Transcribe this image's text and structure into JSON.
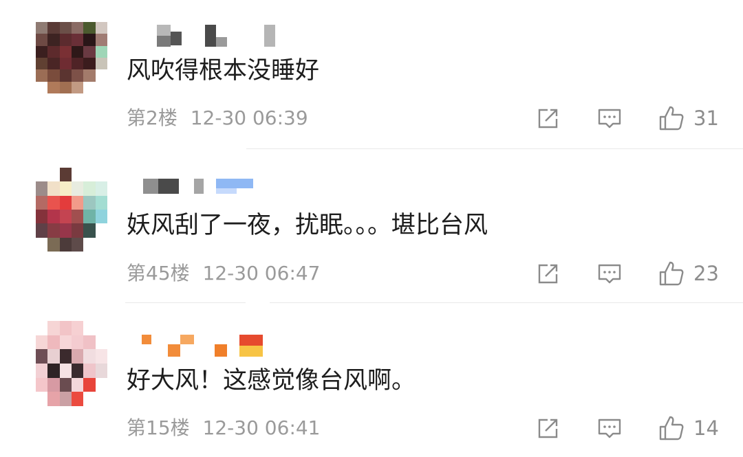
{
  "comments": [
    {
      "text": "风吹得根本没睡好",
      "floor": "第2楼",
      "time": "12-30 06:39",
      "likes": "31",
      "share_icon": "share-icon",
      "reply_icon": "comment-icon",
      "like_icon": "thumbs-up-icon"
    },
    {
      "text": "妖风刮了一夜，扰眠。。。堪比台风",
      "floor": "第45楼",
      "time": "12-30 06:47",
      "likes": "23",
      "share_icon": "share-icon",
      "reply_icon": "comment-icon",
      "like_icon": "thumbs-up-icon"
    },
    {
      "text": "好大风！这感觉像台风啊。",
      "floor": "第15楼",
      "time": "12-30 06:41",
      "likes": "14",
      "share_icon": "share-icon",
      "reply_icon": "comment-icon",
      "like_icon": "thumbs-up-icon"
    }
  ],
  "colors": {
    "text": "#1d1d1d",
    "meta": "#9a9a9a",
    "icon": "#8a8a8a",
    "divider": "#e8e8e8"
  }
}
